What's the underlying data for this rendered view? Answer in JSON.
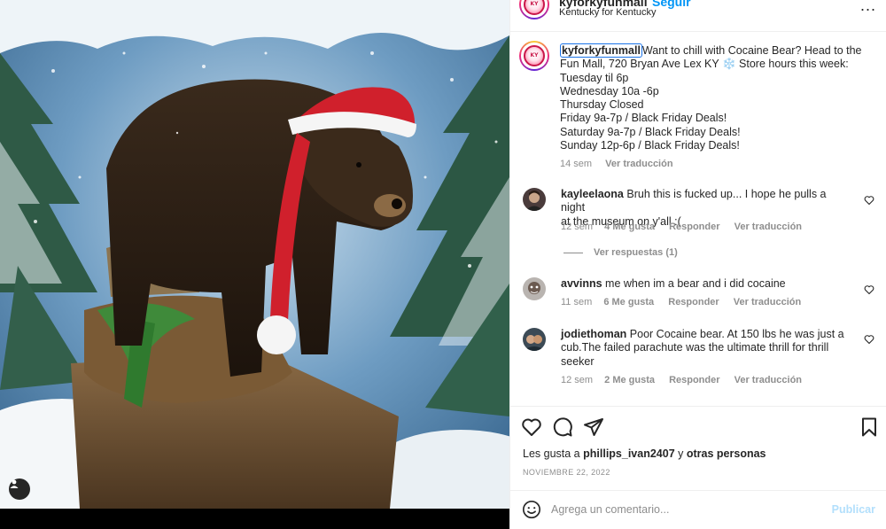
{
  "header": {
    "username": "kyforkyfunmall",
    "follow_label": "Seguir",
    "location": "Kentucky for Kentucky",
    "more_label": "..."
  },
  "caption": {
    "username": "kyforkyfunmall",
    "lines": [
      "Want to chill with Cocaine Bear? Head to the",
      "Fun Mall, 720 Bryan Ave Lex KY ❄️ Store hours this week:",
      "Tuesday til 6p",
      "Wednesday 10a -6p",
      "Thursday Closed",
      "Friday 9a-7p / Black Friday Deals!",
      "Saturday 9a-7p / Black Friday Deals!",
      "Sunday 12p-6p / Black Friday Deals!"
    ],
    "time": "14 sem",
    "translate": "Ver traducción"
  },
  "comments": [
    {
      "username": "kayleelaona",
      "text_lines": [
        "Bruh this is fucked up... I hope he pulls a night",
        "at the museum on y'all :("
      ],
      "time": "12 sem",
      "likes": "4 Me gusta",
      "reply": "Responder",
      "translate": "Ver traducción"
    },
    {
      "username": "avvinns",
      "text_lines": [
        "me when im a bear and i did cocaine"
      ],
      "time": "11 sem",
      "likes": "6 Me gusta",
      "reply": "Responder",
      "translate": "Ver traducción"
    },
    {
      "username": "jodiethoman",
      "text_lines": [
        "Poor Cocaine bear. At 150 lbs he was just a",
        "cub.The failed parachute was the ultimate thrill for thrill",
        "seeker"
      ],
      "time": "12 sem",
      "likes": "2 Me gusta",
      "reply": "Responder",
      "translate": "Ver traducción"
    }
  ],
  "view_replies": "Ver respuestas (1)",
  "likes_line": {
    "prefix": "Les gusta a",
    "user": "phillips_ivan2407",
    "middle": "y",
    "others": "otras personas"
  },
  "date": "NOVIEMBRE 22, 2022",
  "add_comment": {
    "placeholder": "Agrega un comentario...",
    "post_label": "Publicar"
  },
  "icons": [
    "heart-icon",
    "comment-icon",
    "share-icon",
    "bookmark-icon",
    "emoji-icon",
    "user-tag-icon",
    "more-icon"
  ],
  "colors": {
    "link_blue": "#0095f6",
    "post_disabled": "#b2dffc",
    "muted": "#8e8e8e",
    "text": "#262626"
  }
}
